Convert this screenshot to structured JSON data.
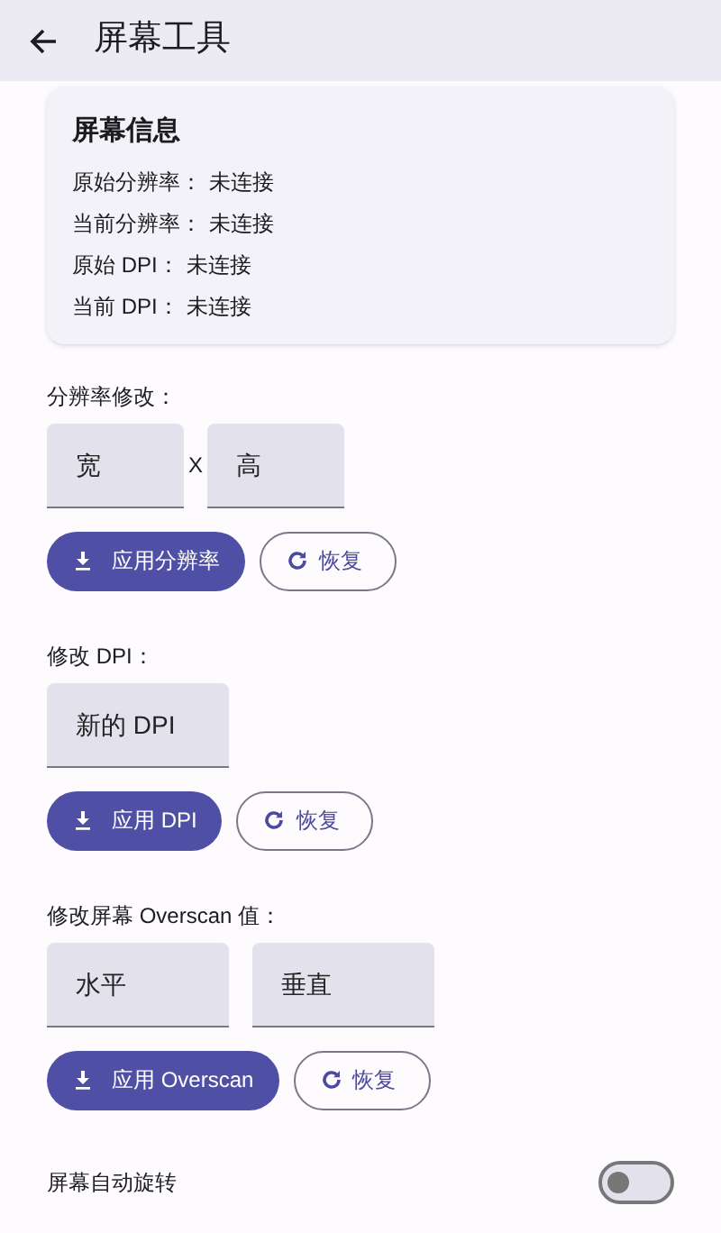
{
  "top_bar": {
    "title": "屏幕工具"
  },
  "info_card": {
    "title": "屏幕信息",
    "rows": [
      {
        "label": "原始分辨率：",
        "value": "未连接"
      },
      {
        "label": "当前分辨率：",
        "value": "未连接"
      },
      {
        "label": "原始 DPI：",
        "value": "未连接"
      },
      {
        "label": "当前 DPI：",
        "value": "未连接"
      }
    ]
  },
  "sections": [
    {
      "label": "分辨率修改：",
      "fields": [
        {
          "placeholder": "宽"
        },
        {
          "placeholder": "高"
        }
      ],
      "separator": "X",
      "apply_button": "应用分辨率",
      "reset_button": "恢复"
    },
    {
      "label": "修改 DPI：",
      "fields": [
        {
          "placeholder": "新的 DPI"
        }
      ],
      "apply_button": "应用 DPI",
      "reset_button": "恢复"
    },
    {
      "label": "修改屏幕 Overscan 值：",
      "fields": [
        {
          "placeholder": "水平"
        },
        {
          "placeholder": "垂直"
        }
      ],
      "apply_button": "应用 Overscan",
      "reset_button": "恢复"
    }
  ],
  "auto_rotate": {
    "label": "屏幕自动旋转",
    "on": false
  }
}
